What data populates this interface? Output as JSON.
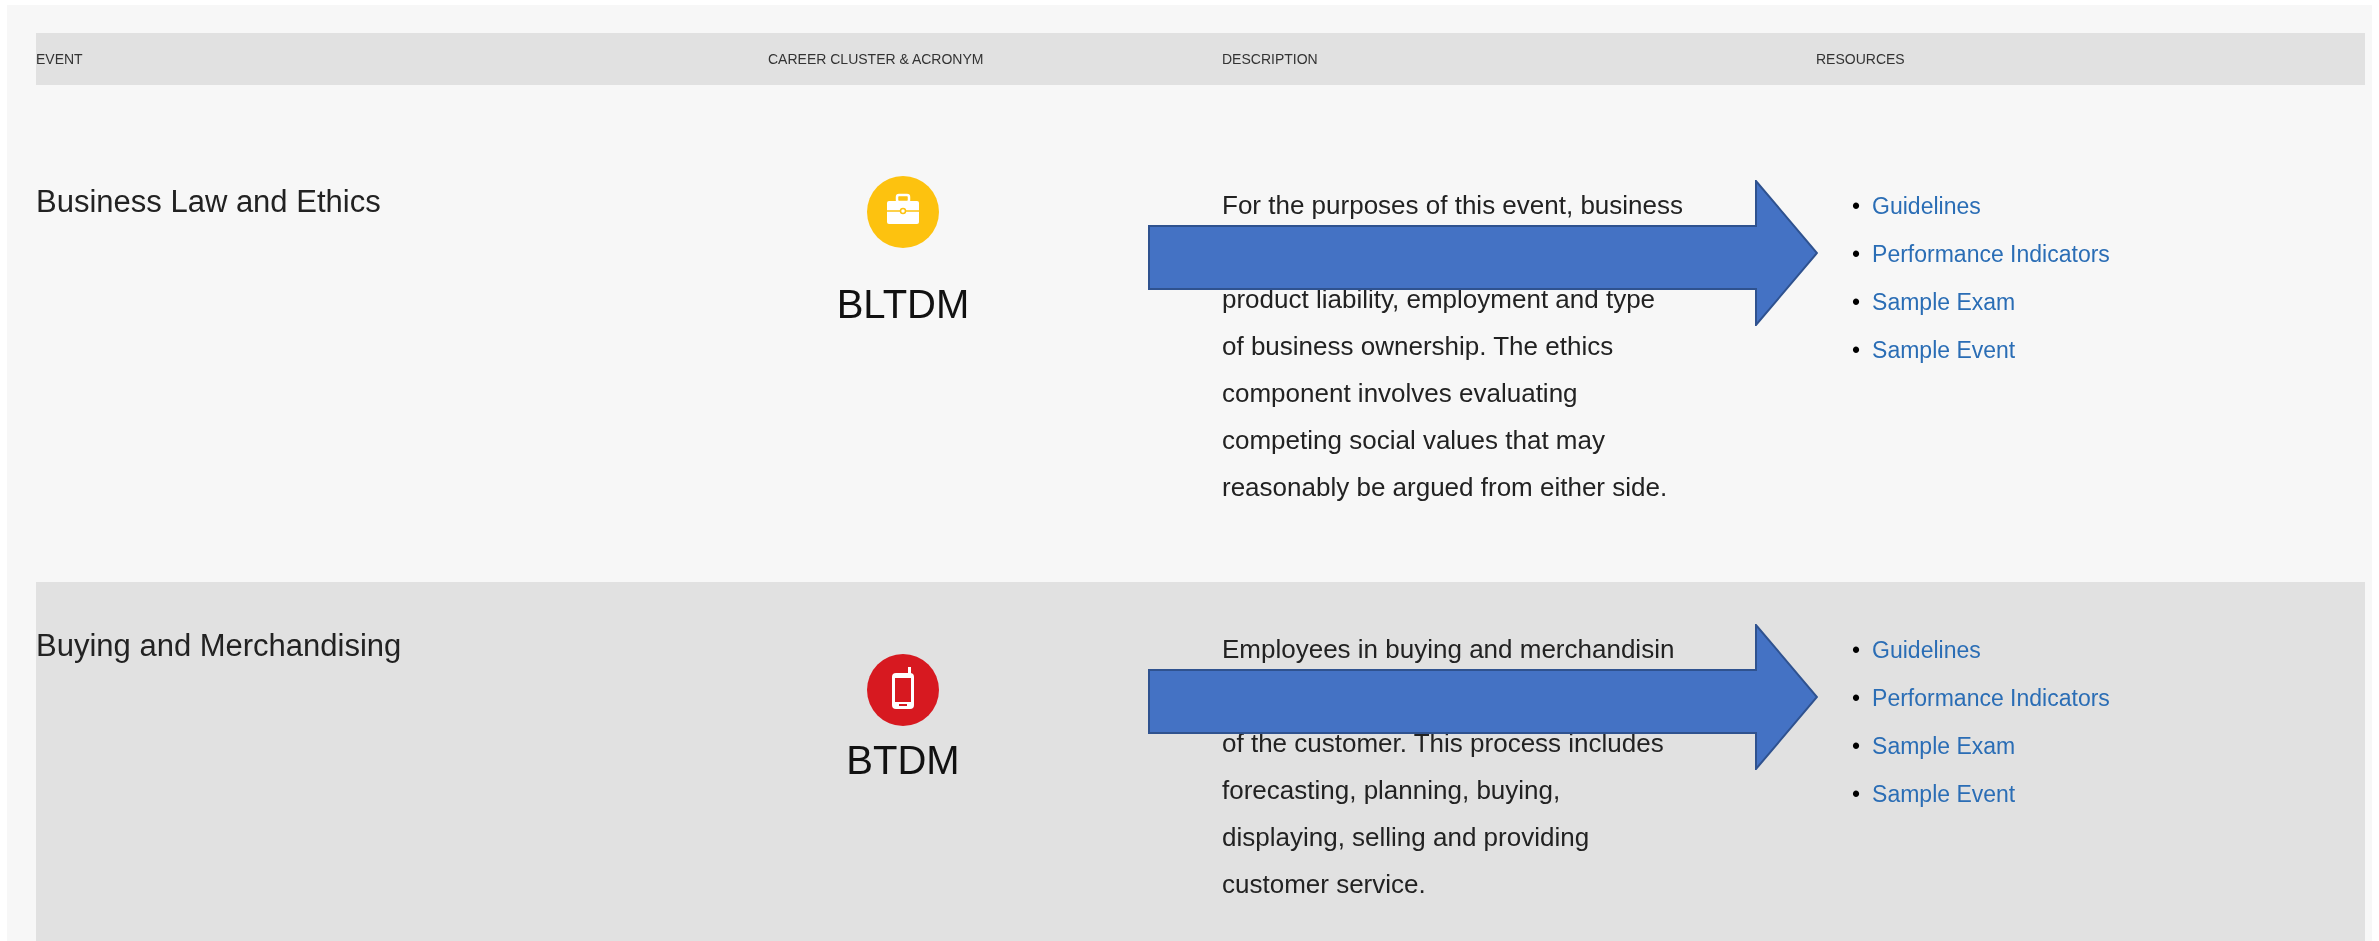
{
  "table": {
    "columns": [
      "EVENT",
      "CAREER CLUSTER & ACRONYM",
      "DESCRIPTION",
      "RESOURCES"
    ],
    "rows": [
      {
        "event": "Business Law and Ethics",
        "cluster_icon": {
          "kind": "briefcase",
          "color": "#fdc20f"
        },
        "acronym": "BLTDM",
        "description_above": [
          "For the purposes of this event, business"
        ],
        "description_below": [
          "product liability, employment and type",
          "of business ownership. The ethics",
          "component involves evaluating",
          "competing social values that may",
          "reasonably be argued from either side."
        ],
        "overlay": {
          "kind": "arrow"
        },
        "resource_marker": "•",
        "resources": [
          "Guidelines",
          "Performance Indicators",
          "Sample Exam",
          "Sample Event"
        ]
      },
      {
        "event": "Buying and Merchandising",
        "cluster_icon": {
          "kind": "phone",
          "color": "#d71920"
        },
        "acronym": "BTDM",
        "description_above": [
          "Employees in buying and merchandisin"
        ],
        "description_below": [
          "of the customer. This process includes",
          "forecasting, planning, buying,",
          "displaying, selling and providing",
          "customer service."
        ],
        "overlay": {
          "kind": "arrow"
        },
        "resource_marker": "•",
        "resources": [
          "Guidelines",
          "Performance Indicators",
          "Sample Exam",
          "Sample Event"
        ]
      }
    ]
  }
}
